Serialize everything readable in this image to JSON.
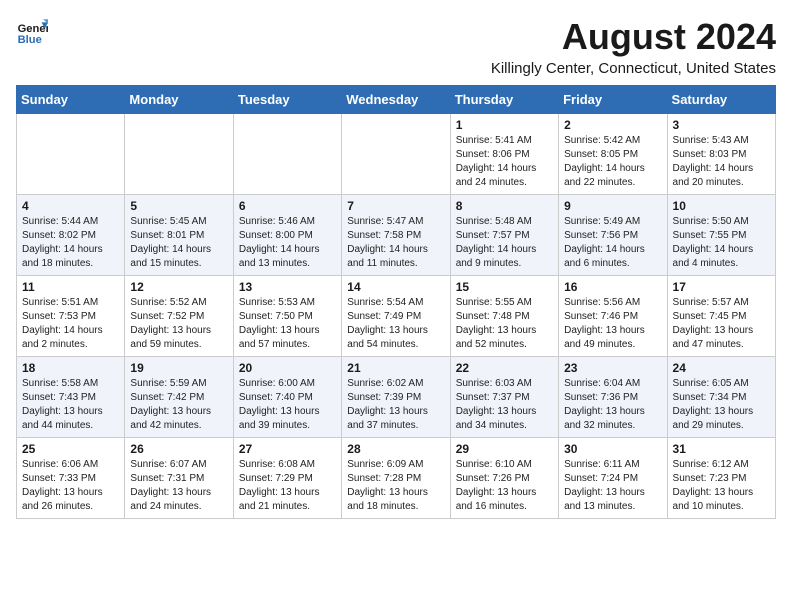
{
  "logo": {
    "line1": "General",
    "line2": "Blue"
  },
  "title": "August 2024",
  "location": "Killingly Center, Connecticut, United States",
  "days_of_week": [
    "Sunday",
    "Monday",
    "Tuesday",
    "Wednesday",
    "Thursday",
    "Friday",
    "Saturday"
  ],
  "weeks": [
    [
      {
        "day": "",
        "info": ""
      },
      {
        "day": "",
        "info": ""
      },
      {
        "day": "",
        "info": ""
      },
      {
        "day": "",
        "info": ""
      },
      {
        "day": "1",
        "info": "Sunrise: 5:41 AM\nSunset: 8:06 PM\nDaylight: 14 hours\nand 24 minutes."
      },
      {
        "day": "2",
        "info": "Sunrise: 5:42 AM\nSunset: 8:05 PM\nDaylight: 14 hours\nand 22 minutes."
      },
      {
        "day": "3",
        "info": "Sunrise: 5:43 AM\nSunset: 8:03 PM\nDaylight: 14 hours\nand 20 minutes."
      }
    ],
    [
      {
        "day": "4",
        "info": "Sunrise: 5:44 AM\nSunset: 8:02 PM\nDaylight: 14 hours\nand 18 minutes."
      },
      {
        "day": "5",
        "info": "Sunrise: 5:45 AM\nSunset: 8:01 PM\nDaylight: 14 hours\nand 15 minutes."
      },
      {
        "day": "6",
        "info": "Sunrise: 5:46 AM\nSunset: 8:00 PM\nDaylight: 14 hours\nand 13 minutes."
      },
      {
        "day": "7",
        "info": "Sunrise: 5:47 AM\nSunset: 7:58 PM\nDaylight: 14 hours\nand 11 minutes."
      },
      {
        "day": "8",
        "info": "Sunrise: 5:48 AM\nSunset: 7:57 PM\nDaylight: 14 hours\nand 9 minutes."
      },
      {
        "day": "9",
        "info": "Sunrise: 5:49 AM\nSunset: 7:56 PM\nDaylight: 14 hours\nand 6 minutes."
      },
      {
        "day": "10",
        "info": "Sunrise: 5:50 AM\nSunset: 7:55 PM\nDaylight: 14 hours\nand 4 minutes."
      }
    ],
    [
      {
        "day": "11",
        "info": "Sunrise: 5:51 AM\nSunset: 7:53 PM\nDaylight: 14 hours\nand 2 minutes."
      },
      {
        "day": "12",
        "info": "Sunrise: 5:52 AM\nSunset: 7:52 PM\nDaylight: 13 hours\nand 59 minutes."
      },
      {
        "day": "13",
        "info": "Sunrise: 5:53 AM\nSunset: 7:50 PM\nDaylight: 13 hours\nand 57 minutes."
      },
      {
        "day": "14",
        "info": "Sunrise: 5:54 AM\nSunset: 7:49 PM\nDaylight: 13 hours\nand 54 minutes."
      },
      {
        "day": "15",
        "info": "Sunrise: 5:55 AM\nSunset: 7:48 PM\nDaylight: 13 hours\nand 52 minutes."
      },
      {
        "day": "16",
        "info": "Sunrise: 5:56 AM\nSunset: 7:46 PM\nDaylight: 13 hours\nand 49 minutes."
      },
      {
        "day": "17",
        "info": "Sunrise: 5:57 AM\nSunset: 7:45 PM\nDaylight: 13 hours\nand 47 minutes."
      }
    ],
    [
      {
        "day": "18",
        "info": "Sunrise: 5:58 AM\nSunset: 7:43 PM\nDaylight: 13 hours\nand 44 minutes."
      },
      {
        "day": "19",
        "info": "Sunrise: 5:59 AM\nSunset: 7:42 PM\nDaylight: 13 hours\nand 42 minutes."
      },
      {
        "day": "20",
        "info": "Sunrise: 6:00 AM\nSunset: 7:40 PM\nDaylight: 13 hours\nand 39 minutes."
      },
      {
        "day": "21",
        "info": "Sunrise: 6:02 AM\nSunset: 7:39 PM\nDaylight: 13 hours\nand 37 minutes."
      },
      {
        "day": "22",
        "info": "Sunrise: 6:03 AM\nSunset: 7:37 PM\nDaylight: 13 hours\nand 34 minutes."
      },
      {
        "day": "23",
        "info": "Sunrise: 6:04 AM\nSunset: 7:36 PM\nDaylight: 13 hours\nand 32 minutes."
      },
      {
        "day": "24",
        "info": "Sunrise: 6:05 AM\nSunset: 7:34 PM\nDaylight: 13 hours\nand 29 minutes."
      }
    ],
    [
      {
        "day": "25",
        "info": "Sunrise: 6:06 AM\nSunset: 7:33 PM\nDaylight: 13 hours\nand 26 minutes."
      },
      {
        "day": "26",
        "info": "Sunrise: 6:07 AM\nSunset: 7:31 PM\nDaylight: 13 hours\nand 24 minutes."
      },
      {
        "day": "27",
        "info": "Sunrise: 6:08 AM\nSunset: 7:29 PM\nDaylight: 13 hours\nand 21 minutes."
      },
      {
        "day": "28",
        "info": "Sunrise: 6:09 AM\nSunset: 7:28 PM\nDaylight: 13 hours\nand 18 minutes."
      },
      {
        "day": "29",
        "info": "Sunrise: 6:10 AM\nSunset: 7:26 PM\nDaylight: 13 hours\nand 16 minutes."
      },
      {
        "day": "30",
        "info": "Sunrise: 6:11 AM\nSunset: 7:24 PM\nDaylight: 13 hours\nand 13 minutes."
      },
      {
        "day": "31",
        "info": "Sunrise: 6:12 AM\nSunset: 7:23 PM\nDaylight: 13 hours\nand 10 minutes."
      }
    ]
  ]
}
